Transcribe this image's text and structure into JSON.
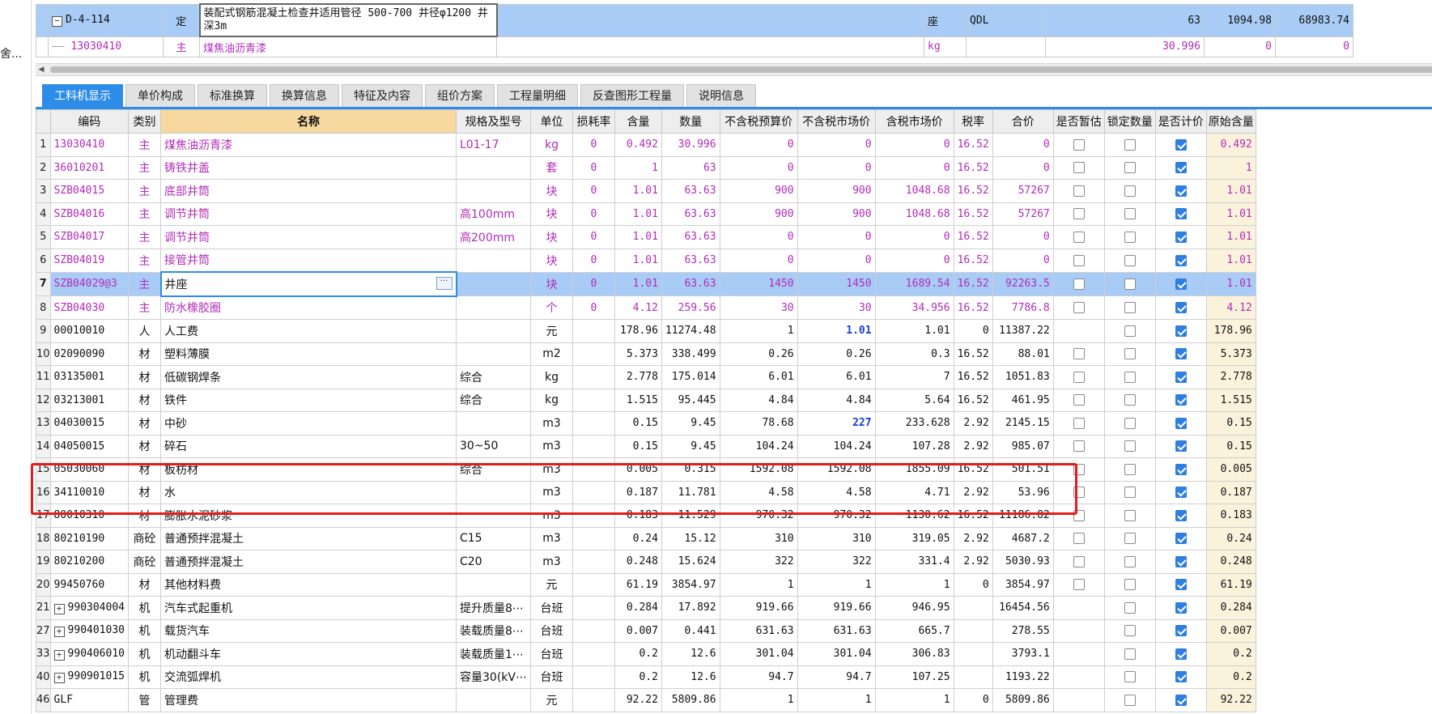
{
  "left_panel": {
    "label": "舍..."
  },
  "top_rows": [
    {
      "code": "D-4-114",
      "type": "定",
      "name": "装配式钢筋混凝土检查井适用管径 500-700 井径φ1200 井深3m",
      "unit": "座",
      "qdl": "QDL",
      "qty": "63",
      "price": "1094.98",
      "total": "68983.74"
    },
    {
      "code": "13030410",
      "type": "主",
      "name": "煤焦油沥青漆",
      "unit": "kg",
      "qdl": "",
      "qty": "30.996",
      "price": "0",
      "total": "0"
    }
  ],
  "tabs": [
    "工料机显示",
    "单价构成",
    "标准换算",
    "换算信息",
    "特征及内容",
    "组价方案",
    "工程量明细",
    "反查图形工程量",
    "说明信息"
  ],
  "columns": [
    "编码",
    "类别",
    "名称",
    "规格及型号",
    "单位",
    "损耗率",
    "含量",
    "数量",
    "不含税预算价",
    "不含税市场价",
    "含税市场价",
    "税率",
    "合价",
    "是否暂估",
    "锁定数量",
    "是否计价",
    "原始含量"
  ],
  "rows": [
    {
      "idx": "1",
      "code": "13030410",
      "cat": "主",
      "name": "煤焦油沥青漆",
      "spec": "L01-17",
      "unit": "kg",
      "loss": "0",
      "content": "0.492",
      "qty": "30.996",
      "pre_budget": "0",
      "pre_market": "0",
      "tax_market": "0",
      "rate": "16.52",
      "total": "0",
      "est": false,
      "lock": false,
      "priced": true,
      "orig": "0.492"
    },
    {
      "idx": "2",
      "code": "36010201",
      "cat": "主",
      "name": "铸铁井盖",
      "spec": "",
      "unit": "套",
      "loss": "0",
      "content": "1",
      "qty": "63",
      "pre_budget": "0",
      "pre_market": "0",
      "tax_market": "0",
      "rate": "16.52",
      "total": "0",
      "est": false,
      "lock": false,
      "priced": true,
      "orig": "1"
    },
    {
      "idx": "3",
      "code": "SZB04015",
      "cat": "主",
      "name": "底部井筒",
      "spec": "",
      "unit": "块",
      "loss": "0",
      "content": "1.01",
      "qty": "63.63",
      "pre_budget": "900",
      "pre_market": "900",
      "tax_market": "1048.68",
      "rate": "16.52",
      "total": "57267",
      "est": false,
      "lock": false,
      "priced": true,
      "orig": "1.01"
    },
    {
      "idx": "4",
      "code": "SZB04016",
      "cat": "主",
      "name": "调节井筒",
      "spec": "高100mm",
      "unit": "块",
      "loss": "0",
      "content": "1.01",
      "qty": "63.63",
      "pre_budget": "900",
      "pre_market": "900",
      "tax_market": "1048.68",
      "rate": "16.52",
      "total": "57267",
      "est": false,
      "lock": false,
      "priced": true,
      "orig": "1.01"
    },
    {
      "idx": "5",
      "code": "SZB04017",
      "cat": "主",
      "name": "调节井筒",
      "spec": "高200mm",
      "unit": "块",
      "loss": "0",
      "content": "1.01",
      "qty": "63.63",
      "pre_budget": "0",
      "pre_market": "0",
      "tax_market": "0",
      "rate": "16.52",
      "total": "0",
      "est": false,
      "lock": false,
      "priced": true,
      "orig": "1.01"
    },
    {
      "idx": "6",
      "code": "SZB04019",
      "cat": "主",
      "name": "接管井筒",
      "spec": "",
      "unit": "块",
      "loss": "0",
      "content": "1.01",
      "qty": "63.63",
      "pre_budget": "0",
      "pre_market": "0",
      "tax_market": "0",
      "rate": "16.52",
      "total": "0",
      "est": false,
      "lock": false,
      "priced": true,
      "orig": "1.01"
    },
    {
      "idx": "7",
      "code": "SZB04029@3",
      "cat": "主",
      "name": "井座",
      "spec": "",
      "unit": "块",
      "loss": "0",
      "content": "1.01",
      "qty": "63.63",
      "pre_budget": "1450",
      "pre_market": "1450",
      "tax_market": "1689.54",
      "rate": "16.52",
      "total": "92263.5",
      "est": false,
      "lock": false,
      "priced": true,
      "orig": "1.01"
    },
    {
      "idx": "8",
      "code": "SZB04030",
      "cat": "主",
      "name": "防水橡胶圈",
      "spec": "",
      "unit": "个",
      "loss": "0",
      "content": "4.12",
      "qty": "259.56",
      "pre_budget": "30",
      "pre_market": "30",
      "tax_market": "34.956",
      "rate": "16.52",
      "total": "7786.8",
      "est": false,
      "lock": false,
      "priced": true,
      "orig": "4.12"
    },
    {
      "idx": "9",
      "code": "00010010",
      "cat": "人",
      "name": "人工费",
      "spec": "",
      "unit": "元",
      "loss": "",
      "content": "178.96",
      "qty": "11274.48",
      "pre_budget": "1",
      "pre_market": "1.01",
      "tax_market": "1.01",
      "rate": "0",
      "total": "11387.22",
      "est": null,
      "lock": false,
      "priced": true,
      "orig": "178.96"
    },
    {
      "idx": "10",
      "code": "02090090",
      "cat": "材",
      "name": "塑料薄膜",
      "spec": "",
      "unit": "m2",
      "loss": "",
      "content": "5.373",
      "qty": "338.499",
      "pre_budget": "0.26",
      "pre_market": "0.26",
      "tax_market": "0.3",
      "rate": "16.52",
      "total": "88.01",
      "est": false,
      "lock": false,
      "priced": true,
      "orig": "5.373"
    },
    {
      "idx": "11",
      "code": "03135001",
      "cat": "材",
      "name": "低碳钢焊条",
      "spec": "综合",
      "unit": "kg",
      "loss": "",
      "content": "2.778",
      "qty": "175.014",
      "pre_budget": "6.01",
      "pre_market": "6.01",
      "tax_market": "7",
      "rate": "16.52",
      "total": "1051.83",
      "est": false,
      "lock": false,
      "priced": true,
      "orig": "2.778"
    },
    {
      "idx": "12",
      "code": "03213001",
      "cat": "材",
      "name": "铁件",
      "spec": "综合",
      "unit": "kg",
      "loss": "",
      "content": "1.515",
      "qty": "95.445",
      "pre_budget": "4.84",
      "pre_market": "4.84",
      "tax_market": "5.64",
      "rate": "16.52",
      "total": "461.95",
      "est": false,
      "lock": false,
      "priced": true,
      "orig": "1.515"
    },
    {
      "idx": "13",
      "code": "04030015",
      "cat": "材",
      "name": "中砂",
      "spec": "",
      "unit": "m3",
      "loss": "",
      "content": "0.15",
      "qty": "9.45",
      "pre_budget": "78.68",
      "pre_market": "227",
      "tax_market": "233.628",
      "rate": "2.92",
      "total": "2145.15",
      "est": false,
      "lock": false,
      "priced": true,
      "orig": "0.15"
    },
    {
      "idx": "14",
      "code": "04050015",
      "cat": "材",
      "name": "碎石",
      "spec": "30~50",
      "unit": "m3",
      "loss": "",
      "content": "0.15",
      "qty": "9.45",
      "pre_budget": "104.24",
      "pre_market": "104.24",
      "tax_market": "107.28",
      "rate": "2.92",
      "total": "985.07",
      "est": false,
      "lock": false,
      "priced": true,
      "orig": "0.15"
    },
    {
      "idx": "15",
      "code": "05030060",
      "cat": "材",
      "name": "板枋材",
      "spec": "综合",
      "unit": "m3",
      "loss": "",
      "content": "0.005",
      "qty": "0.315",
      "pre_budget": "1592.08",
      "pre_market": "1592.08",
      "tax_market": "1855.09",
      "rate": "16.52",
      "total": "501.51",
      "est": false,
      "lock": false,
      "priced": true,
      "orig": "0.005"
    },
    {
      "idx": "16",
      "code": "34110010",
      "cat": "材",
      "name": "水",
      "spec": "",
      "unit": "m3",
      "loss": "",
      "content": "0.187",
      "qty": "11.781",
      "pre_budget": "4.58",
      "pre_market": "4.58",
      "tax_market": "4.71",
      "rate": "2.92",
      "total": "53.96",
      "est": false,
      "lock": false,
      "priced": true,
      "orig": "0.187"
    },
    {
      "idx": "17",
      "code": "80010310",
      "cat": "材",
      "name": "膨胀水泥砂浆",
      "spec": "",
      "unit": "m3",
      "loss": "",
      "content": "0.183",
      "qty": "11.529",
      "pre_budget": "970.32",
      "pre_market": "970.32",
      "tax_market": "1130.62",
      "rate": "16.52",
      "total": "11186.82",
      "est": false,
      "lock": false,
      "priced": true,
      "orig": "0.183"
    },
    {
      "idx": "18",
      "code": "80210190",
      "cat": "商砼",
      "name": "普通预拌混凝土",
      "spec": "C15",
      "unit": "m3",
      "loss": "",
      "content": "0.24",
      "qty": "15.12",
      "pre_budget": "310",
      "pre_market": "310",
      "tax_market": "319.05",
      "rate": "2.92",
      "total": "4687.2",
      "est": false,
      "lock": false,
      "priced": true,
      "orig": "0.24"
    },
    {
      "idx": "19",
      "code": "80210200",
      "cat": "商砼",
      "name": "普通预拌混凝土",
      "spec": "C20",
      "unit": "m3",
      "loss": "",
      "content": "0.248",
      "qty": "15.624",
      "pre_budget": "322",
      "pre_market": "322",
      "tax_market": "331.4",
      "rate": "2.92",
      "total": "5030.93",
      "est": false,
      "lock": false,
      "priced": true,
      "orig": "0.248"
    },
    {
      "idx": "20",
      "code": "99450760",
      "cat": "材",
      "name": "其他材料费",
      "spec": "",
      "unit": "元",
      "loss": "",
      "content": "61.19",
      "qty": "3854.97",
      "pre_budget": "1",
      "pre_market": "1",
      "tax_market": "1",
      "rate": "0",
      "total": "3854.97",
      "est": false,
      "lock": false,
      "priced": true,
      "orig": "61.19"
    },
    {
      "idx": "21",
      "code": "990304004",
      "cat": "机",
      "name": "汽车式起重机",
      "spec": "提升质量8⋯",
      "unit": "台班",
      "loss": "",
      "content": "0.284",
      "qty": "17.892",
      "pre_budget": "919.66",
      "pre_market": "919.66",
      "tax_market": "946.95",
      "rate": "",
      "total": "16454.56",
      "est": null,
      "lock": false,
      "priced": true,
      "orig": "0.284",
      "expand": true
    },
    {
      "idx": "27",
      "code": "990401030",
      "cat": "机",
      "name": "载货汽车",
      "spec": "装载质量8⋯",
      "unit": "台班",
      "loss": "",
      "content": "0.007",
      "qty": "0.441",
      "pre_budget": "631.63",
      "pre_market": "631.63",
      "tax_market": "665.7",
      "rate": "",
      "total": "278.55",
      "est": null,
      "lock": false,
      "priced": true,
      "orig": "0.007",
      "expand": true
    },
    {
      "idx": "33",
      "code": "990406010",
      "cat": "机",
      "name": "机动翻斗车",
      "spec": "装载质量1⋯",
      "unit": "台班",
      "loss": "",
      "content": "0.2",
      "qty": "12.6",
      "pre_budget": "301.04",
      "pre_market": "301.04",
      "tax_market": "306.83",
      "rate": "",
      "total": "3793.1",
      "est": null,
      "lock": false,
      "priced": true,
      "orig": "0.2",
      "expand": true
    },
    {
      "idx": "40",
      "code": "990901015",
      "cat": "机",
      "name": "交流弧焊机",
      "spec": "容量30(kV⋯",
      "unit": "台班",
      "loss": "",
      "content": "0.2",
      "qty": "12.6",
      "pre_budget": "94.7",
      "pre_market": "94.7",
      "tax_market": "107.25",
      "rate": "",
      "total": "1193.22",
      "est": null,
      "lock": false,
      "priced": true,
      "orig": "0.2",
      "expand": true
    },
    {
      "idx": "46",
      "code": "GLF",
      "cat": "管",
      "name": "管理费",
      "spec": "",
      "unit": "元",
      "loss": "",
      "content": "92.22",
      "qty": "5809.86",
      "pre_budget": "1",
      "pre_market": "1",
      "tax_market": "1",
      "rate": "0",
      "total": "5809.86",
      "est": null,
      "lock": false,
      "priced": true,
      "orig": "92.22"
    }
  ],
  "colors": {
    "accent": "#2d8ce8",
    "selection": "#a8ccf5",
    "main_material": "#b22cb8",
    "highlight_box": "#e21c1c",
    "edited_value": "#1a3dd6"
  }
}
